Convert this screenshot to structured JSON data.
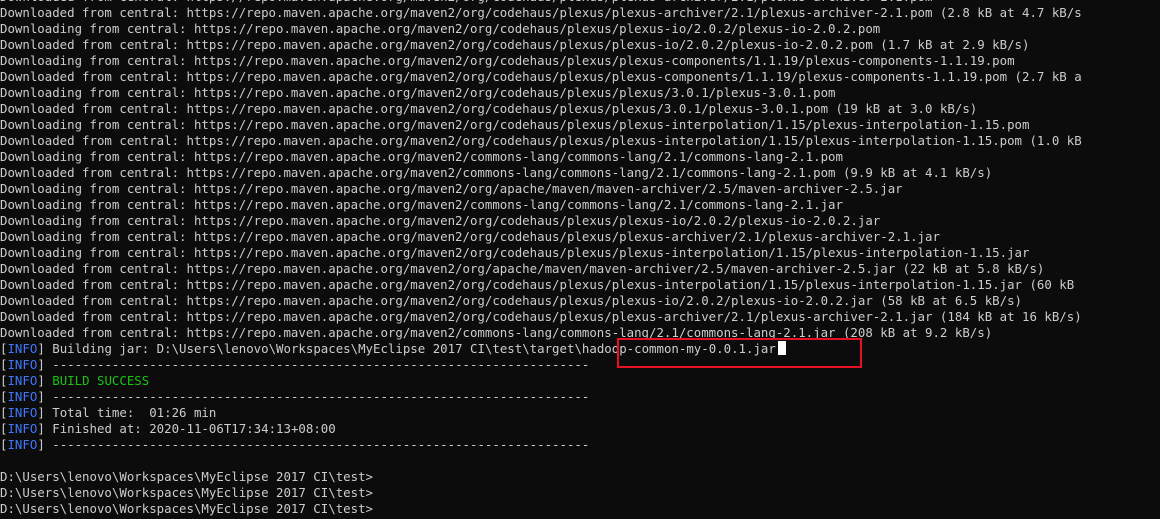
{
  "terminal": {
    "download_lines": [
      "Downloaded from central: https://repo.maven.apache.org/maven2/org/codehaus/plexus/plexus-archiver/2.1/plexus-archiver-2.1.pom",
      "Downloaded from central: https://repo.maven.apache.org/maven2/org/codehaus/plexus/plexus-archiver/2.1/plexus-archiver-2.1.pom (2.8 kB at 4.7 kB/s",
      "Downloading from central: https://repo.maven.apache.org/maven2/org/codehaus/plexus/plexus-io/2.0.2/plexus-io-2.0.2.pom",
      "Downloaded from central: https://repo.maven.apache.org/maven2/org/codehaus/plexus/plexus-io/2.0.2/plexus-io-2.0.2.pom (1.7 kB at 2.9 kB/s)",
      "Downloading from central: https://repo.maven.apache.org/maven2/org/codehaus/plexus/plexus-components/1.1.19/plexus-components-1.1.19.pom",
      "Downloaded from central: https://repo.maven.apache.org/maven2/org/codehaus/plexus/plexus-components/1.1.19/plexus-components-1.1.19.pom (2.7 kB a",
      "Downloading from central: https://repo.maven.apache.org/maven2/org/codehaus/plexus/plexus/3.0.1/plexus-3.0.1.pom",
      "Downloaded from central: https://repo.maven.apache.org/maven2/org/codehaus/plexus/plexus/3.0.1/plexus-3.0.1.pom (19 kB at 3.0 kB/s)",
      "Downloading from central: https://repo.maven.apache.org/maven2/org/codehaus/plexus/plexus-interpolation/1.15/plexus-interpolation-1.15.pom",
      "Downloaded from central: https://repo.maven.apache.org/maven2/org/codehaus/plexus/plexus-interpolation/1.15/plexus-interpolation-1.15.pom (1.0 kB",
      "Downloading from central: https://repo.maven.apache.org/maven2/commons-lang/commons-lang/2.1/commons-lang-2.1.pom",
      "Downloaded from central: https://repo.maven.apache.org/maven2/commons-lang/commons-lang/2.1/commons-lang-2.1.pom (9.9 kB at 4.1 kB/s)",
      "Downloading from central: https://repo.maven.apache.org/maven2/org/apache/maven/maven-archiver/2.5/maven-archiver-2.5.jar",
      "Downloading from central: https://repo.maven.apache.org/maven2/commons-lang/commons-lang/2.1/commons-lang-2.1.jar",
      "Downloading from central: https://repo.maven.apache.org/maven2/org/codehaus/plexus/plexus-io/2.0.2/plexus-io-2.0.2.jar",
      "Downloading from central: https://repo.maven.apache.org/maven2/org/codehaus/plexus/plexus-archiver/2.1/plexus-archiver-2.1.jar",
      "Downloading from central: https://repo.maven.apache.org/maven2/org/codehaus/plexus/plexus-interpolation/1.15/plexus-interpolation-1.15.jar",
      "Downloaded from central: https://repo.maven.apache.org/maven2/org/apache/maven/maven-archiver/2.5/maven-archiver-2.5.jar (22 kB at 5.8 kB/s)",
      "Downloaded from central: https://repo.maven.apache.org/maven2/org/codehaus/plexus/plexus-interpolation/1.15/plexus-interpolation-1.15.jar (60 kB",
      "Downloaded from central: https://repo.maven.apache.org/maven2/org/codehaus/plexus/plexus-io/2.0.2/plexus-io-2.0.2.jar (58 kB at 6.5 kB/s)",
      "Downloaded from central: https://repo.maven.apache.org/maven2/org/codehaus/plexus/plexus-archiver/2.1/plexus-archiver-2.1.jar (184 kB at 16 kB/s)",
      "Downloaded from central: https://repo.maven.apache.org/maven2/commons-lang/commons-lang/2.1/commons-lang-2.1.jar (208 kB at 9.2 kB/s)"
    ],
    "info_tag": "INFO",
    "build_line_prefix": " Building jar: D:\\Users\\lenovo\\Workspaces\\MyEclipse 2017 CI\\test\\target",
    "build_line_jar": "\\hadoop-common-my-0.0.1.jar",
    "separator": " ------------------------------------------------------------------------",
    "build_success": " BUILD SUCCESS",
    "total_time": " Total time:  01:26 min",
    "finished_at": " Finished at: 2020-11-06T17:34:13+08:00",
    "prompts": [
      "D:\\Users\\lenovo\\Workspaces\\MyEclipse 2017 CI\\test>",
      "D:\\Users\\lenovo\\Workspaces\\MyEclipse 2017 CI\\test>",
      "D:\\Users\\lenovo\\Workspaces\\MyEclipse 2017 CI\\test>"
    ]
  },
  "colors": {
    "background": "#0c0c0c",
    "text": "#cccccc",
    "info": "#3b78ff",
    "success": "#16c60c",
    "highlight": "#e81123"
  }
}
